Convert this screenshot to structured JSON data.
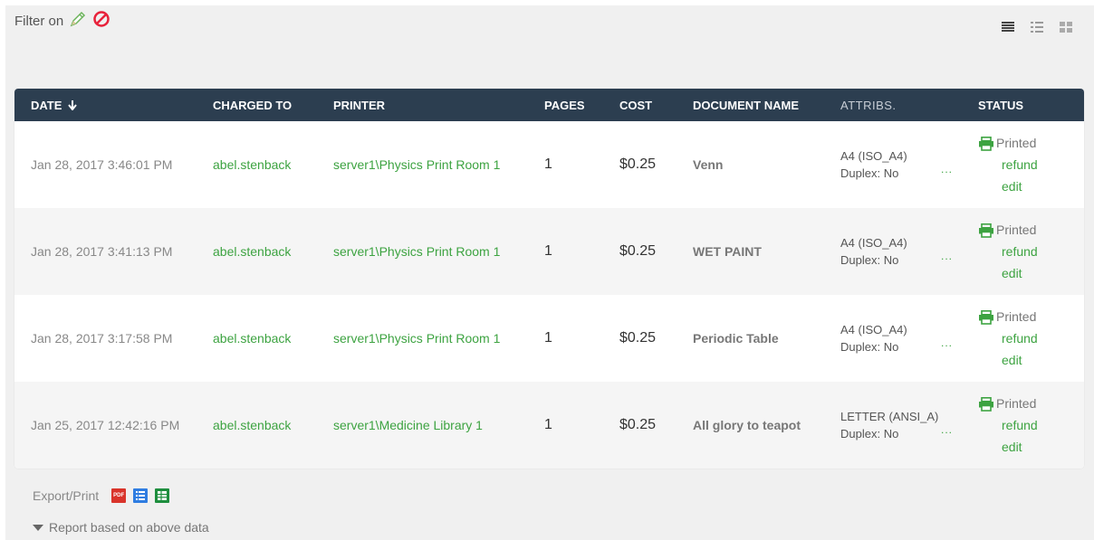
{
  "filter": {
    "label": "Filter on"
  },
  "table": {
    "headers": [
      "DATE",
      "CHARGED TO",
      "PRINTER",
      "PAGES",
      "COST",
      "DOCUMENT NAME",
      "ATTRIBS.",
      "STATUS"
    ],
    "sort_icon": "arrow-down-icon",
    "rows": [
      {
        "date": "Jan 28, 2017 3:46:01 PM",
        "charged_to": "abel.stenback",
        "printer": "server1\\Physics Print Room 1",
        "pages": "1",
        "cost": "$0.25",
        "document": "Venn",
        "attr_size": "A4 (ISO_A4)",
        "attr_duplex": "Duplex: No",
        "more": "...",
        "status": "Printed",
        "refund": "refund",
        "edit": "edit"
      },
      {
        "date": "Jan 28, 2017 3:41:13 PM",
        "charged_to": "abel.stenback",
        "printer": "server1\\Physics Print Room 1",
        "pages": "1",
        "cost": "$0.25",
        "document": "WET PAINT",
        "attr_size": "A4 (ISO_A4)",
        "attr_duplex": "Duplex: No",
        "more": "...",
        "status": "Printed",
        "refund": "refund",
        "edit": "edit"
      },
      {
        "date": "Jan 28, 2017 3:17:58 PM",
        "charged_to": "abel.stenback",
        "printer": "server1\\Physics Print Room 1",
        "pages": "1",
        "cost": "$0.25",
        "document": "Periodic Table",
        "attr_size": "A4 (ISO_A4)",
        "attr_duplex": "Duplex: No",
        "more": "...",
        "status": "Printed",
        "refund": "refund",
        "edit": "edit"
      },
      {
        "date": "Jan 25, 2017 12:42:16 PM",
        "charged_to": "abel.stenback",
        "printer": "server1\\Medicine Library 1",
        "pages": "1",
        "cost": "$0.25",
        "document": "All glory to teapot",
        "attr_size": "LETTER (ANSI_A)",
        "attr_duplex": "Duplex: No",
        "more": "...",
        "status": "Printed",
        "refund": "refund",
        "edit": "edit"
      }
    ]
  },
  "export": {
    "label": "Export/Print",
    "pdf_text": "PDF"
  },
  "report": {
    "label": "Report based on above data"
  },
  "colors": {
    "header_bg": "#2c3e50",
    "link_green": "#3da341",
    "clear_red": "#e8213a",
    "pdf_red": "#d9342b"
  }
}
